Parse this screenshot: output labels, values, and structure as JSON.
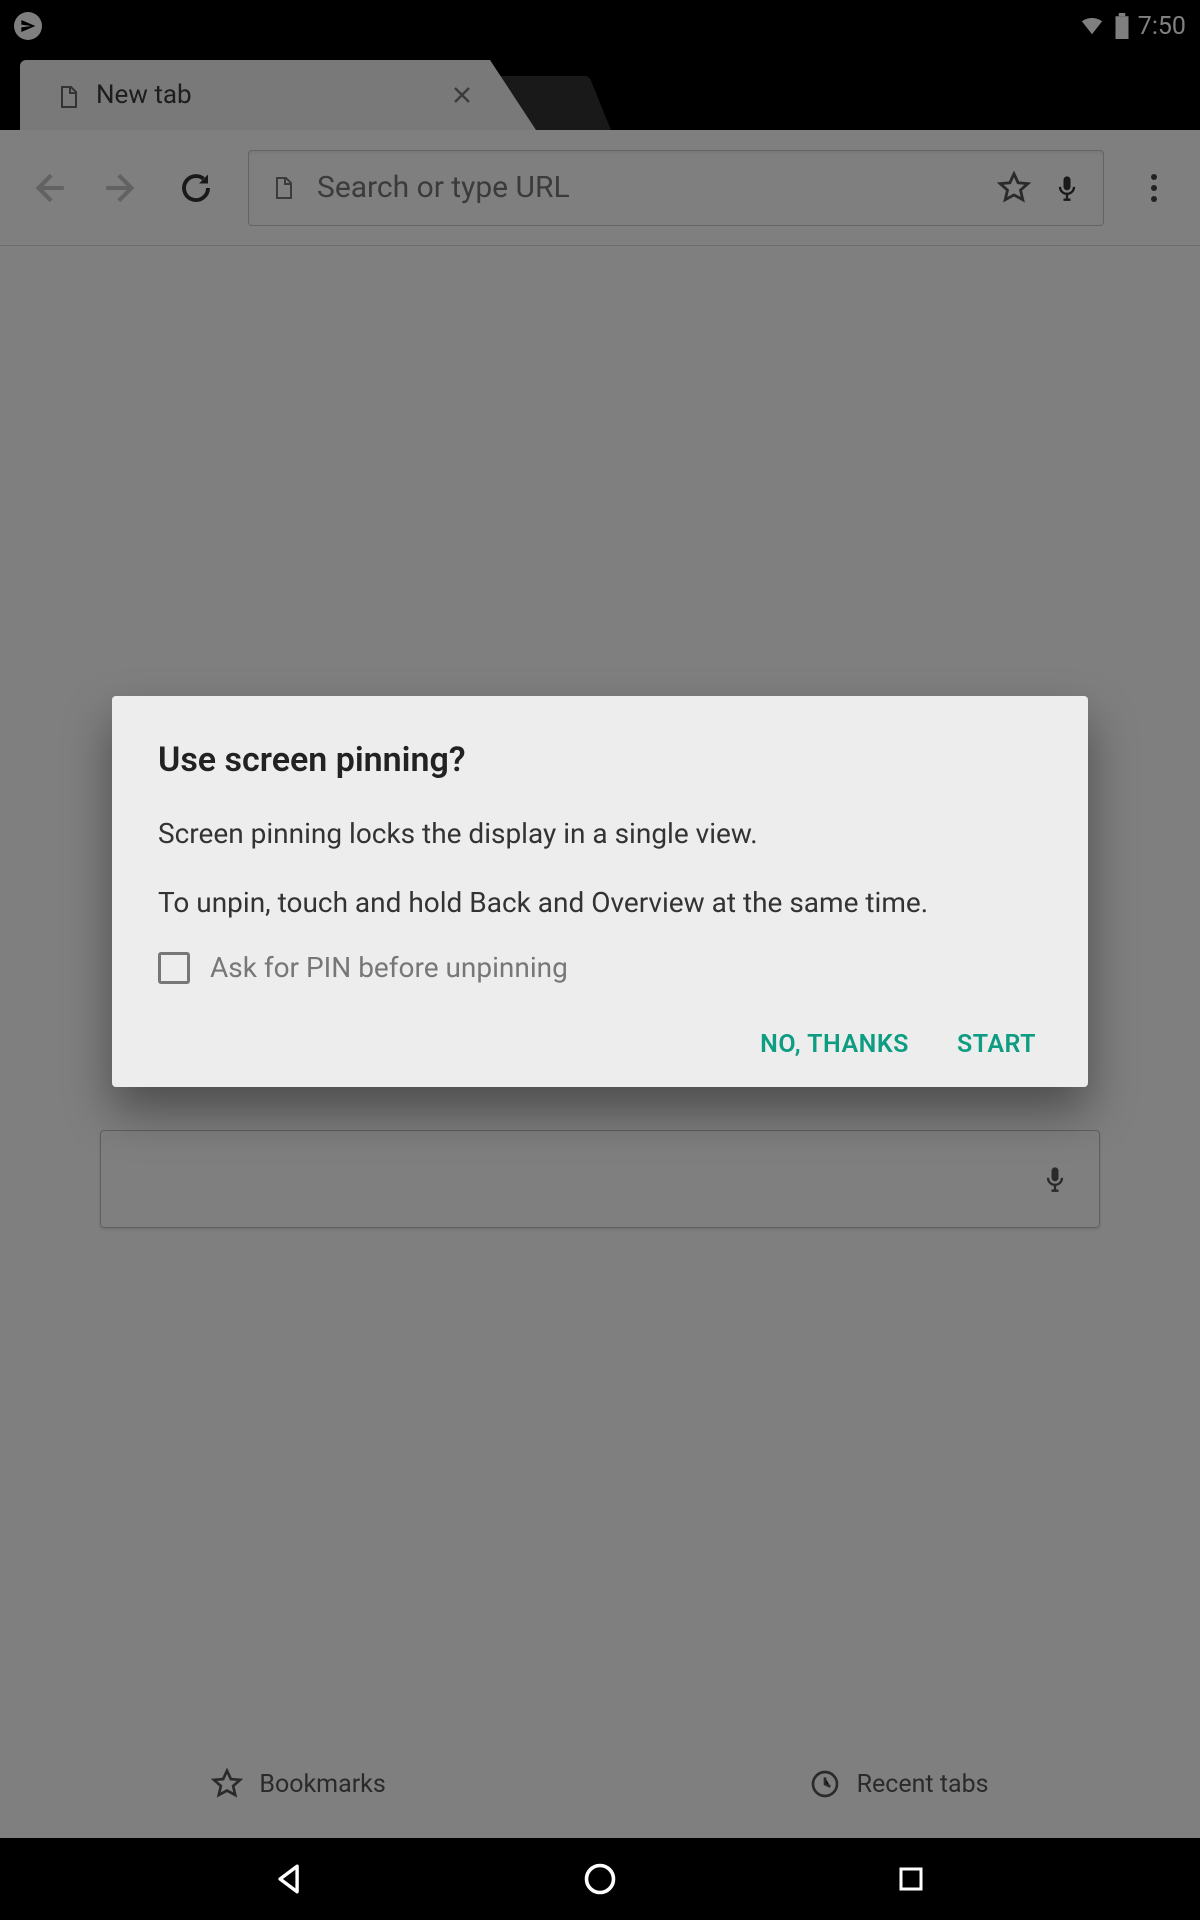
{
  "status": {
    "time": "7:50"
  },
  "tab": {
    "title": "New tab"
  },
  "omnibox": {
    "placeholder": "Search or type URL"
  },
  "ntp": {
    "bookmarks_label": "Bookmarks",
    "recent_label": "Recent tabs"
  },
  "dialog": {
    "title": "Use screen pinning?",
    "line1": "Screen pinning locks the display in a single view.",
    "line2": "To unpin, touch and hold Back and Overview at the same time.",
    "checkbox_label": "Ask for PIN before unpinning",
    "no_label": "NO, THANKS",
    "start_label": "START"
  },
  "colors": {
    "accent": "#0d9d82"
  }
}
